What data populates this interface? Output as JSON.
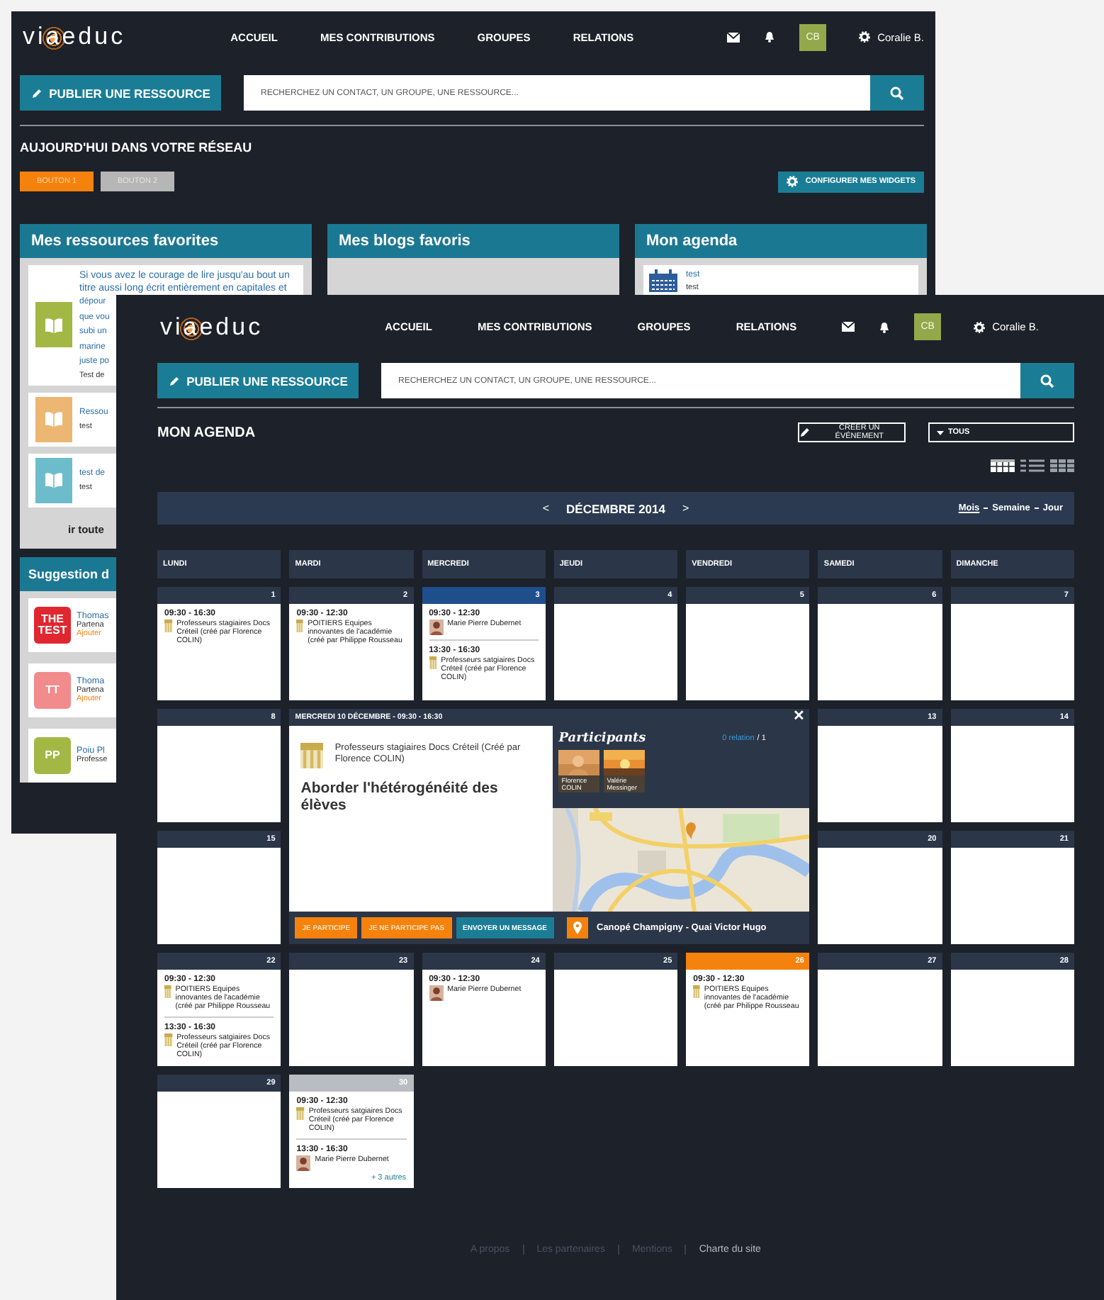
{
  "back_window": {
    "header": {
      "logo": "viaeduc",
      "nav": [
        "ACCUEIL",
        "MES CONTRIBUTIONS",
        "GROUPES",
        "RELATIONS"
      ],
      "avatar": "CB",
      "user": "Coralie B."
    },
    "publish_button": "PUBLIER UNE RESSOURCE",
    "search": {
      "placeholder": "RECHERCHEZ UN CONTACT, UN GROUPE, UNE RESSOURCE..."
    },
    "section_title": "AUJOURD'HUI DANS VOTRE RÉSEAU",
    "filter_buttons": [
      {
        "label": "BOUTON 1",
        "selected": true
      },
      {
        "label": "BOUTON 2",
        "selected": false
      }
    ],
    "configure_button": "CONFIGURER MES WIDGETS",
    "widgets": [
      {
        "kind": "resources",
        "title": "Mes ressources favorites",
        "items": [
          {
            "color": "#a3b745",
            "text": "Si vous avez le courage de lire jusqu'au bout un titre aussi long écrit entièrement en capitales et",
            "cut_lines": [
              "dépour",
              "que vou",
              "subi un",
              "marine",
              "juste po"
            ],
            "subtitle": "Test de"
          },
          {
            "color": "#ecb673",
            "cut_lines": [
              "Ressou"
            ],
            "subtitle": "test"
          },
          {
            "color": "#6cbccc",
            "cut_lines": [
              "test de"
            ],
            "subtitle": "test"
          }
        ],
        "more_link": "ir toute"
      },
      {
        "kind": "blogs",
        "title": "Mes blogs favoris"
      },
      {
        "kind": "agenda",
        "title": "Mon agenda",
        "items": [
          {
            "title": "test",
            "subtitle": "test"
          }
        ]
      },
      {
        "kind": "people",
        "title": "Suggestion d",
        "people": [
          {
            "avatar": "THE TEST",
            "color": "#e0262f",
            "name": "Thomas",
            "role": "Partena",
            "action": "Ajouter"
          },
          {
            "avatar": "TT",
            "color": "#f28b8b",
            "name": "Thoma",
            "role": "Partena",
            "action": "Ajouter"
          },
          {
            "avatar": "PP",
            "color": "#a3b745",
            "name": "Poiu Pl",
            "role": "Professe"
          }
        ]
      }
    ]
  },
  "front_window": {
    "header": {
      "logo": "viaeduc",
      "nav": [
        "ACCUEIL",
        "MES CONTRIBUTIONS",
        "GROUPES",
        "RELATIONS"
      ],
      "avatar": "CB",
      "user": "Coralie B."
    },
    "publish_button": "PUBLIER UNE RESSOURCE",
    "search": {
      "placeholder": "RECHERCHEZ UN CONTACT, UN GROUPE, UNE RESSOURCE..."
    },
    "page_title": "MON AGENDA",
    "create_button": "CRÉER UN ÉVÉNEMENT",
    "filter": {
      "value": "TOUS"
    },
    "view_modes": [
      {
        "kind": "month",
        "selected": true
      },
      {
        "kind": "list",
        "selected": false
      },
      {
        "kind": "grid",
        "selected": false
      }
    ],
    "month_bar": {
      "previous": "<",
      "title": "DÉCEMBRE 2014",
      "next": ">",
      "views": [
        {
          "label": "Mois",
          "selected": true
        },
        {
          "label": "Semaine",
          "selected": false
        },
        {
          "label": "Jour",
          "selected": false
        }
      ]
    },
    "calendar": {
      "weekdays": [
        "LUNDI",
        "MARDI",
        "MERCREDI",
        "JEUDI",
        "VENDREDI",
        "SAMEDI",
        "DIMANCHE"
      ],
      "days": [
        {
          "kind": "day",
          "number": "1",
          "events": [
            {
              "kind": "group",
              "time": "09:30 - 16:30",
              "text": "Professeurs stagiaires Docs Créteil (créé par Florence COLIN)"
            }
          ]
        },
        {
          "kind": "day",
          "number": "2",
          "events": [
            {
              "kind": "group",
              "time": "09:30 - 12:30",
              "text": "POITIERS Equipes innovantes de l'académie (créé par Philippe Rousseau"
            }
          ]
        },
        {
          "kind": "day",
          "number": "3",
          "color": "#1f4e8c",
          "events": [
            {
              "kind": "person",
              "time": "09:30 - 12:30",
              "text": "Marie Pierre Dubernet"
            },
            {
              "kind": "group",
              "time": "13:30 - 16:30",
              "text": "Professeurs satgiaires Docs Créteil (créé par Florence COLIN)"
            }
          ]
        },
        {
          "kind": "day",
          "number": "4"
        },
        {
          "kind": "day",
          "number": "5"
        },
        {
          "kind": "day",
          "number": "6"
        },
        {
          "kind": "day",
          "number": "7"
        },
        {
          "kind": "day",
          "number": "8"
        },
        {
          "kind": "event_detail",
          "header": "MERCREDI 10 DÉCEMBRE - 09:30 - 16:30",
          "close": "✕",
          "group": "Professeurs stagiaires Docs Créteil (Créé par Florence COLIN)",
          "title": "Aborder l'hétérogénéité des élèves",
          "participants_title": "Participants",
          "relation_link": "0 relation",
          "relation_total": "/ 1",
          "participants": [
            "Florence COLIN",
            "Valérie Messinger"
          ],
          "actions": [
            {
              "kind": "accent",
              "label": "JE PARTICIPE"
            },
            {
              "kind": "accent",
              "label": "JE NE PARTICIPE PAS"
            },
            {
              "kind": "info",
              "label": "ENVOYER UN MESSAGE"
            }
          ],
          "location": "Canopé Champigny - Quai Victor Hugo"
        },
        {
          "kind": "day",
          "number": "13"
        },
        {
          "kind": "day",
          "number": "14"
        },
        {
          "kind": "day",
          "number": "15"
        },
        {
          "kind": "day",
          "number": "20"
        },
        {
          "kind": "day",
          "number": "21"
        },
        {
          "kind": "day",
          "number": "22",
          "events": [
            {
              "kind": "group",
              "time": "09:30 - 12:30",
              "text": "POITIERS Equipes innovantes de l'académie (créé par Philippe Rousseau"
            },
            {
              "kind": "group",
              "time": "13:30 - 16:30",
              "text": "Professeurs satgiaires Docs Créteil (créé par Florence COLIN)"
            }
          ]
        },
        {
          "kind": "day",
          "number": "23"
        },
        {
          "kind": "day",
          "number": "24",
          "events": [
            {
              "kind": "person",
              "time": "09:30 - 12:30",
              "text": "Marie Pierre Dubernet"
            }
          ]
        },
        {
          "kind": "day",
          "number": "25"
        },
        {
          "kind": "day",
          "number": "26",
          "color": "#f5820d",
          "events": [
            {
              "kind": "group",
              "time": "09:30 - 12:30",
              "text": "POITIERS Equipes innovantes de l'académie (créé par Philippe Rousseau"
            }
          ]
        },
        {
          "kind": "day",
          "number": "27"
        },
        {
          "kind": "day",
          "number": "28"
        },
        {
          "kind": "day",
          "number": "29"
        },
        {
          "kind": "day",
          "number": "30",
          "color": "#b9bdc3",
          "events": [
            {
              "kind": "group",
              "time": "09:30 - 12:30",
              "text": "Professeurs satgiaires Docs Créteil (créé par Florence COLIN)"
            },
            {
              "kind": "person",
              "time": "13:30 - 16:30",
              "text": "Marie Pierre Dubernet"
            }
          ],
          "more": "+ 3 autres"
        }
      ]
    },
    "footer": [
      {
        "label": "A propos",
        "current": false
      },
      {
        "label": "Les partenaires",
        "current": false
      },
      {
        "label": "Mentions",
        "current": false
      },
      {
        "label": "Charte du site",
        "current": true
      }
    ]
  }
}
